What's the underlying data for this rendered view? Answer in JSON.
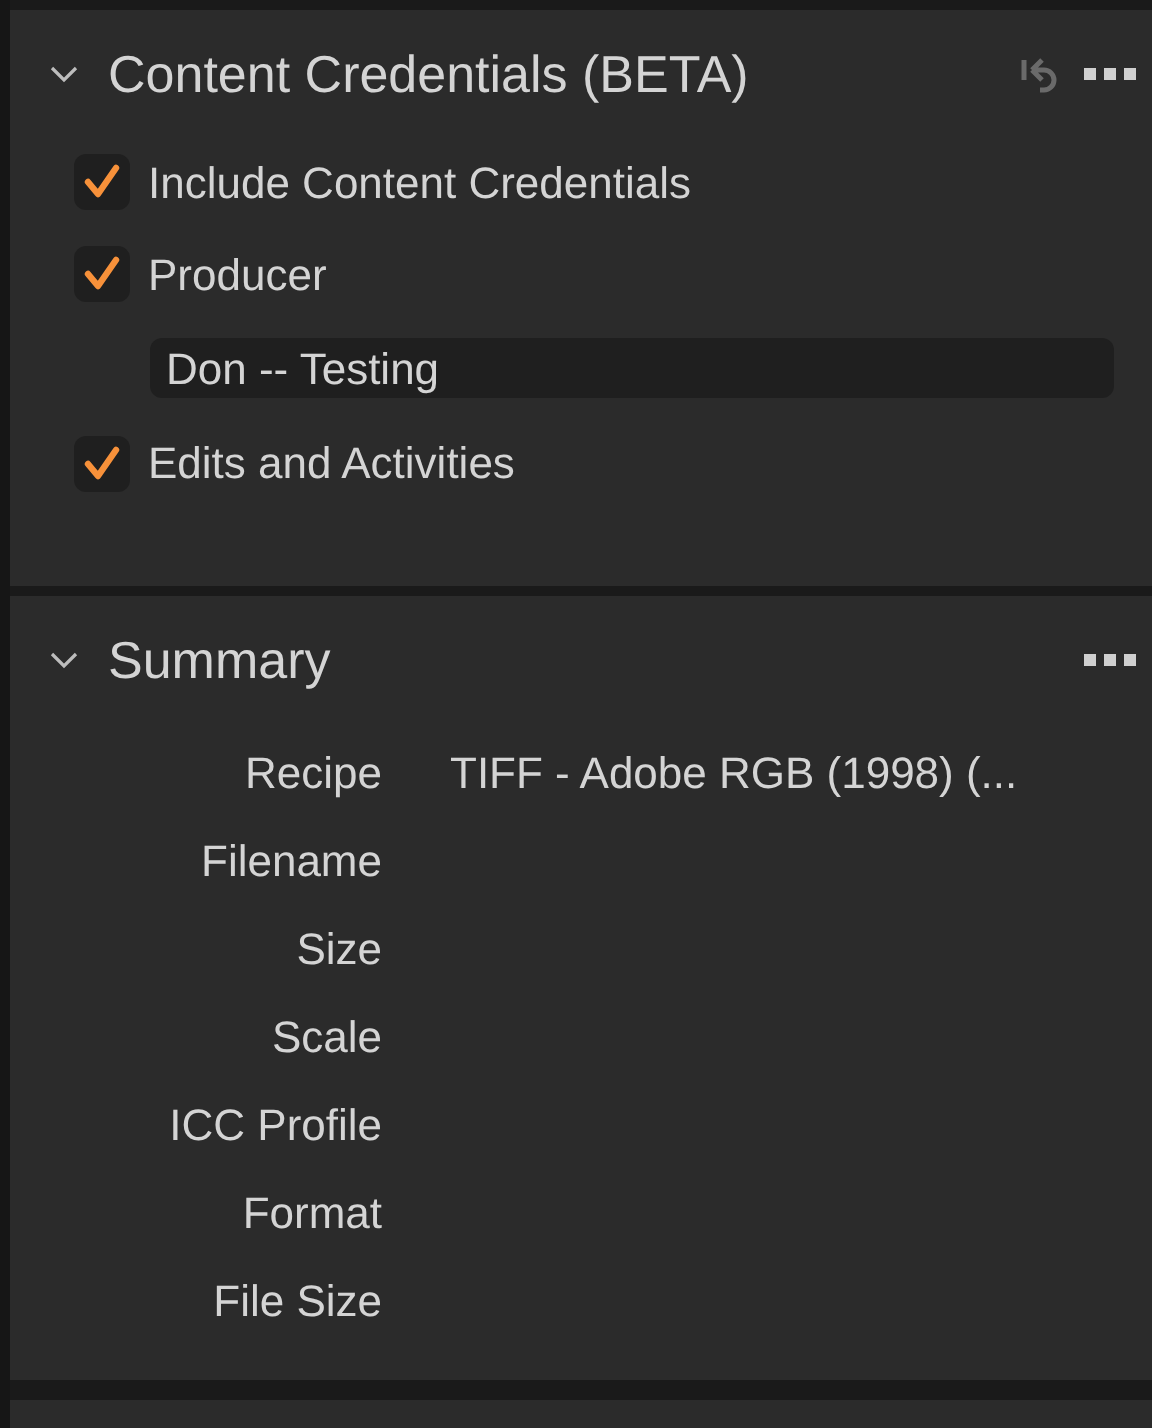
{
  "credentials": {
    "title": "Content Credentials (BETA)",
    "expanded": true,
    "options": [
      {
        "kind": "checkbox",
        "label": "Include Content Credentials",
        "checked": true
      },
      {
        "kind": "checkbox",
        "label": "Producer",
        "checked": true
      },
      {
        "kind": "field",
        "value": "Don -- Testing"
      },
      {
        "kind": "checkbox",
        "label": "Edits and Activities",
        "checked": true
      }
    ]
  },
  "summary": {
    "title": "Summary",
    "expanded": true,
    "rows": [
      {
        "label": "Recipe",
        "value": "TIFF - Adobe RGB (1998) (..."
      },
      {
        "label": "Filename"
      },
      {
        "label": "Size"
      },
      {
        "label": "Scale"
      },
      {
        "label": "ICC Profile"
      },
      {
        "label": "Format"
      },
      {
        "label": "File Size"
      }
    ]
  }
}
